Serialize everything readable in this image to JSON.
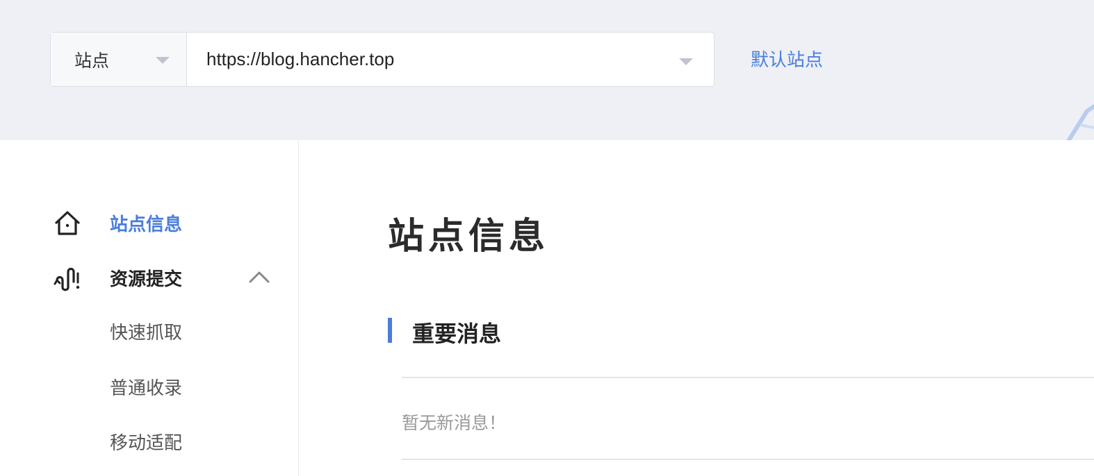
{
  "header": {
    "type_select": {
      "value": "站点",
      "icon": "chevron-down-icon"
    },
    "url_select": {
      "value": "https://blog.hancher.top",
      "icon": "chevron-down-icon"
    },
    "default_link": "默认站点",
    "colors": {
      "background": "#eef0f6",
      "accent": "#4a7ddb"
    }
  },
  "sidebar": {
    "items": [
      {
        "label": "站点信息",
        "icon": "home-icon",
        "active": true
      },
      {
        "label": "资源提交",
        "icon": "submit-link-icon",
        "expanded": true,
        "children": [
          {
            "label": "快速抓取"
          },
          {
            "label": "普通收录"
          },
          {
            "label": "移动适配"
          }
        ]
      }
    ]
  },
  "main": {
    "title": "站点信息",
    "section": {
      "title": "重要消息",
      "empty_text": "暂无新消息！"
    }
  }
}
